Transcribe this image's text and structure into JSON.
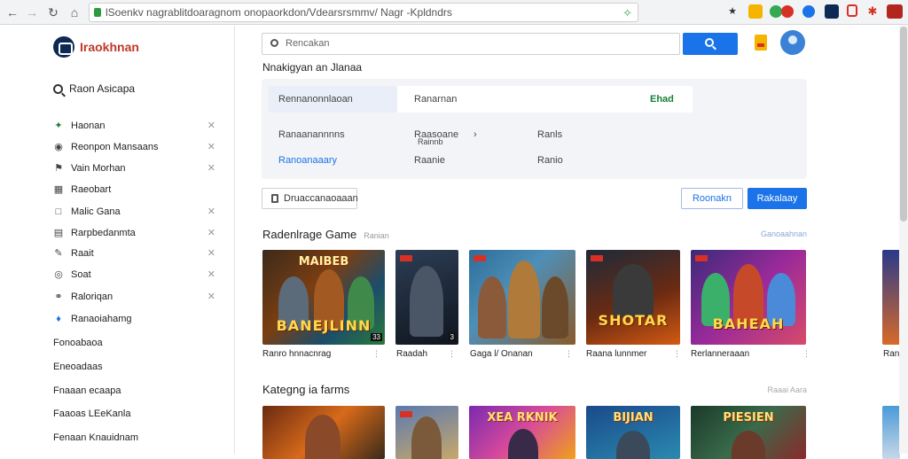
{
  "browser": {
    "url": "lSoenkv nagrablitdoaragnom onopaorkdon/Vdearsrsmmv/ Nagr -Kpldndrs",
    "back_icon": "arrow-left-icon",
    "forward_icon": "arrow-right-icon"
  },
  "sidebar": {
    "logo_text": "Iraokhnan",
    "search_label": "Raon Asicapa",
    "items": [
      {
        "label": "Haonan",
        "icon": "gamepad-icon",
        "chevron": true,
        "color": "#188038"
      },
      {
        "label": "Reonpon Mansaans",
        "icon": "pin-icon",
        "chevron": true
      },
      {
        "label": "Vain Morhan",
        "icon": "flag-icon",
        "chevron": true
      },
      {
        "label": "Raeobart",
        "icon": "grid-icon",
        "chevron": false
      },
      {
        "label": "Malic Gana",
        "icon": "square-icon",
        "chevron": true
      },
      {
        "label": "Rarpbedanmta",
        "icon": "list-icon",
        "chevron": true
      },
      {
        "label": "Raait",
        "icon": "pencil-icon",
        "chevron": true
      },
      {
        "label": "Soat",
        "icon": "target-icon",
        "chevron": true
      },
      {
        "label": "Raloriqan",
        "icon": "link-icon",
        "chevron": true
      },
      {
        "label": "Ranaoiahamg",
        "icon": "tag-icon",
        "chevron": false
      }
    ],
    "plain_items": [
      "Fonoabaoa",
      "Eneoadaas",
      "Fnaaan ecaapa",
      "Faaoas LEeKanla",
      "Fenaan Knauidnam"
    ]
  },
  "main": {
    "search_placeholder": "Rencakan",
    "heading": "Nnakigyan an Jlanaa",
    "panel": {
      "row1_a": "Rennanonnlaoan",
      "row1_b": "Ranarnan",
      "row1_c": "Ehad",
      "row2_a": "Ranaanannnns",
      "row2_b": "Raasoane",
      "row2_b2": "Rainnb",
      "row2_c": "Ranls",
      "row3_a": "Ranoanaaary",
      "row3_b": "Raanie",
      "row3_c": "Ranio"
    },
    "outline_button": "Druaccanaoaaan",
    "secondary_button": "Roonakn",
    "primary_button": "Rakalaay",
    "section1": {
      "title": "Radenlrage Game",
      "subtitle": "Ranian",
      "link": "Ganoaahnan",
      "cards": [
        {
          "top": "MAIBEB",
          "bottom": "BANEJLINN",
          "caption": "Ranro hnnacnrag",
          "num": "33"
        },
        {
          "top": "",
          "bottom": "",
          "caption": "Raadah",
          "num": "3"
        },
        {
          "top": "",
          "bottom": "",
          "caption": "Gaga l/ Onanan",
          "num": ""
        },
        {
          "top": "",
          "bottom": "SHOTAR",
          "caption": "Raana lunnmer",
          "num": ""
        },
        {
          "top": "",
          "bottom": "BAHEAH",
          "caption": "Rerlanneraaan",
          "num": ""
        },
        {
          "top": "",
          "bottom": "",
          "caption": "Ranaa",
          "num": ""
        }
      ]
    },
    "section2": {
      "title": "Kategng ia farms",
      "link": "Raaai Aara",
      "cards": [
        {
          "top": "",
          "bottom": ""
        },
        {
          "top": "",
          "bottom": ""
        },
        {
          "top": "XEA RKNIK",
          "bottom": ""
        },
        {
          "top": "BIJIAN",
          "bottom": ""
        },
        {
          "top": "PIESIEN",
          "bottom": ""
        },
        {
          "top": "",
          "bottom": ""
        }
      ]
    }
  }
}
